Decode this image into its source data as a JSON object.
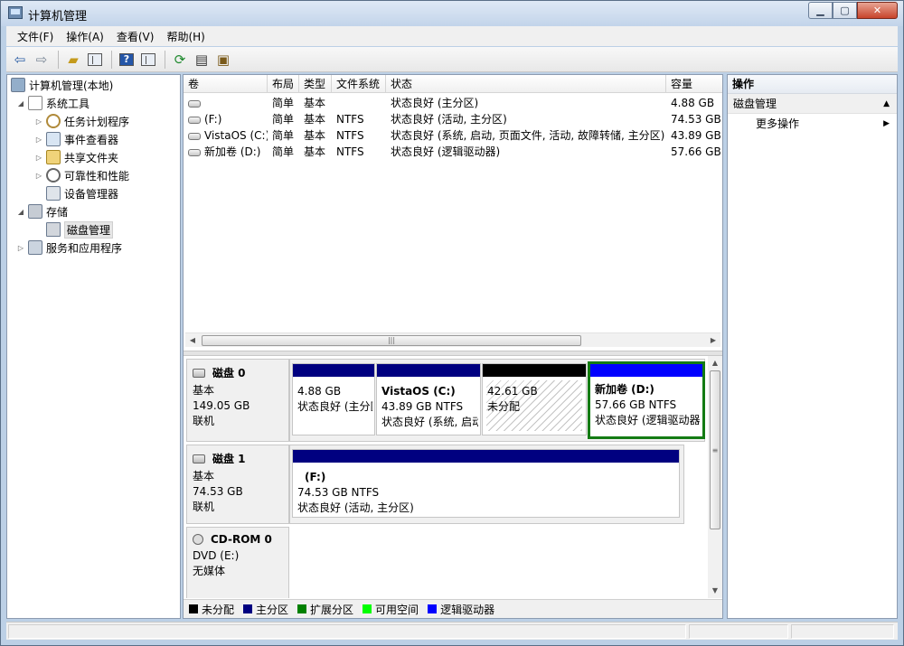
{
  "window": {
    "title": "计算机管理"
  },
  "menu": [
    "文件(F)",
    "操作(A)",
    "查看(V)",
    "帮助(H)"
  ],
  "tree": {
    "root": "计算机管理(本地)",
    "system_tools": "系统工具",
    "task_scheduler": "任务计划程序",
    "event_viewer": "事件查看器",
    "shared_folders": "共享文件夹",
    "reliability": "可靠性和性能",
    "device_manager": "设备管理器",
    "storage": "存储",
    "disk_management": "磁盘管理",
    "services": "服务和应用程序"
  },
  "volume_list": {
    "headers": [
      "卷",
      "布局",
      "类型",
      "文件系统",
      "状态",
      "容量"
    ],
    "rows": [
      {
        "volume": "",
        "layout": "简单",
        "type": "基本",
        "fs": "",
        "status": "状态良好 (主分区)",
        "capacity": "4.88 GB"
      },
      {
        "volume": "(F:)",
        "layout": "简单",
        "type": "基本",
        "fs": "NTFS",
        "status": "状态良好 (活动, 主分区)",
        "capacity": "74.53 GB"
      },
      {
        "volume": "VistaOS (C:)",
        "layout": "简单",
        "type": "基本",
        "fs": "NTFS",
        "status": "状态良好 (系统, 启动, 页面文件, 活动, 故障转储, 主分区)",
        "capacity": "43.89 GB"
      },
      {
        "volume": "新加卷 (D:)",
        "layout": "简单",
        "type": "基本",
        "fs": "NTFS",
        "status": "状态良好 (逻辑驱动器)",
        "capacity": "57.66 GB"
      }
    ]
  },
  "disks": [
    {
      "name": "磁盘 0",
      "kind": "基本",
      "size": "149.05 GB",
      "state": "联机",
      "partitions": [
        {
          "name": "",
          "size": "4.88 GB",
          "status": "状态良好 (主分区)"
        },
        {
          "name": "VistaOS  (C:)",
          "size": "43.89 GB NTFS",
          "status": "状态良好 (系统, 启动, 页面文件, 活动, 故障转储, 主分区)"
        },
        {
          "name": "",
          "size": "42.61 GB",
          "status": "未分配"
        },
        {
          "name": "新加卷  (D:)",
          "size": "57.66 GB NTFS",
          "status": "状态良好 (逻辑驱动器)"
        }
      ]
    },
    {
      "name": "磁盘 1",
      "kind": "基本",
      "size": "74.53 GB",
      "state": "联机",
      "partitions": [
        {
          "name": "(F:)",
          "size": "74.53 GB NTFS",
          "status": "状态良好 (活动, 主分区)"
        }
      ]
    },
    {
      "name": "CD-ROM 0",
      "kind": "DVD (E:)",
      "size": "",
      "state": "无媒体"
    }
  ],
  "legend": [
    {
      "label": "未分配",
      "color": "#000000"
    },
    {
      "label": "主分区",
      "color": "#000080"
    },
    {
      "label": "扩展分区",
      "color": "#008000"
    },
    {
      "label": "可用空间",
      "color": "#00ff00"
    },
    {
      "label": "逻辑驱动器",
      "color": "#0000ff"
    }
  ],
  "colors": {
    "primary_partition": "#000080",
    "unallocated": "#000000",
    "logical_drive": "#0000ff",
    "selection": "#137b13"
  },
  "actions": {
    "header": "操作",
    "section": "磁盘管理",
    "more": "更多操作"
  }
}
